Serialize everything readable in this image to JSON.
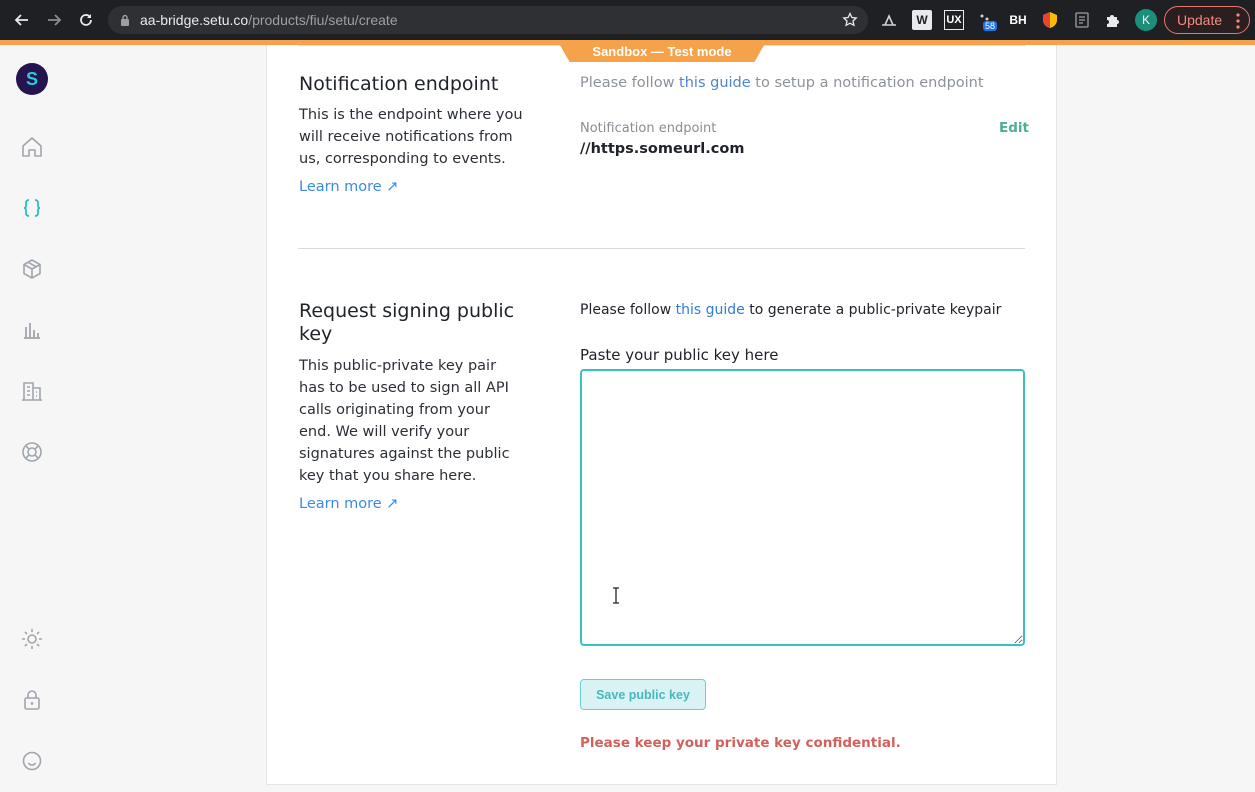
{
  "browser": {
    "url_domain": "aa-bridge.setu.co",
    "url_path": "/products/fiu/setu/create",
    "extension_labels": [
      "W",
      "UX",
      "BH"
    ],
    "badge_count": "58",
    "profile_initial": "K",
    "update_label": "Update"
  },
  "banner": {
    "sandbox_label": "Sandbox — Test mode"
  },
  "sidebar": {
    "logo_letter": "S",
    "icons": [
      "home-icon",
      "code-braces-icon",
      "package-icon",
      "bar-chart-icon",
      "building-icon",
      "lifebuoy-icon",
      "sun-icon",
      "lock-icon",
      "smiley-icon"
    ]
  },
  "notification": {
    "title": "Notification endpoint",
    "description": "This is the endpoint where you will receive notifications from us, corresponding to events.",
    "learn_more": "Learn more ↗",
    "guide_prefix": "Please follow ",
    "guide_link": "this guide",
    "guide_suffix": " to setup a notification endpoint",
    "field_label": "Notification endpoint",
    "field_value": "//https.someurl.com",
    "edit_label": "Edit"
  },
  "signing": {
    "title": "Request signing public key",
    "description": "This public-private key pair has to be used to sign all API calls originating from your end. We will verify your signatures against the public key that you share here.",
    "learn_more": "Learn more ↗",
    "guide_prefix": "Please follow ",
    "guide_link": "this guide",
    "guide_suffix": " to generate a public-private keypair",
    "paste_label": "Paste your public key here",
    "textarea_value": "",
    "save_label": "Save public key",
    "warning": "Please keep your private key confidential."
  },
  "colors": {
    "accent_teal": "#39c1c2",
    "sandbox_orange": "#f5a24a",
    "warning_red": "#d4605c",
    "link_blue": "#2f7ed8",
    "edit_green": "#4fae97"
  }
}
